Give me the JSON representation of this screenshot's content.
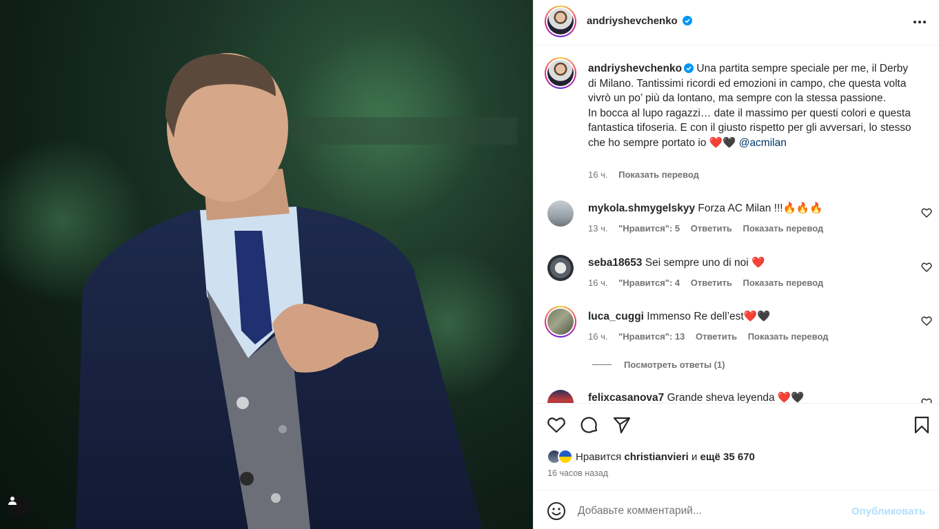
{
  "post": {
    "author": "andriyshevchenko",
    "caption": "Una partita sempre speciale per me, il Derby di Milano. Tantissimi ricordi ed emozioni in campo, che questa volta vivrò un po’ più da lontano, ma sempre con la stessa passione.",
    "caption_2": "In bocca al lupo ragazzi… date il massimo per questi colori e questa fantastica tifoseria. E con il giusto rispetto per gli avversari, lo stesso che ho sempre portato io",
    "caption_emoji": "❤️🖤",
    "mention": "@acmilan",
    "time": "16 ч.",
    "translate": "Показать перевод"
  },
  "comments": [
    {
      "user": "mykola.shmygelskyy",
      "text": "Forza AC Milan !!!🔥🔥🔥",
      "time": "13 ч.",
      "likes": "\"Нравится\": 5",
      "reply": "Ответить",
      "translate": "Показать перевод"
    },
    {
      "user": "seba18653",
      "text": "Sei sempre uno di noi ❤️",
      "time": "16 ч.",
      "likes": "\"Нравится\": 4",
      "reply": "Ответить",
      "translate": "Показать перевод"
    },
    {
      "user": "luca_cuggi",
      "text": "Immenso Re dell’est❤️🖤",
      "time": "16 ч.",
      "likes": "\"Нравится\": 13",
      "reply": "Ответить",
      "translate": "Показать перевод"
    },
    {
      "user": "felixcasanova7",
      "text": "Grande sheva leyenda ❤️🖤"
    }
  ],
  "view_replies": "Посмотреть ответы (1)",
  "likes": {
    "prefix": "Нравится",
    "user": "christianvieri",
    "middle": "и",
    "others": "ещё 35 670"
  },
  "time_ago": "16 часов назад",
  "add_comment": {
    "placeholder": "Добавьте комментарий...",
    "publish": "Опубликовать"
  },
  "colors": {
    "verified": "#0095f6",
    "publish_disabled": "#b2dffc",
    "heart": "#ed4956"
  }
}
